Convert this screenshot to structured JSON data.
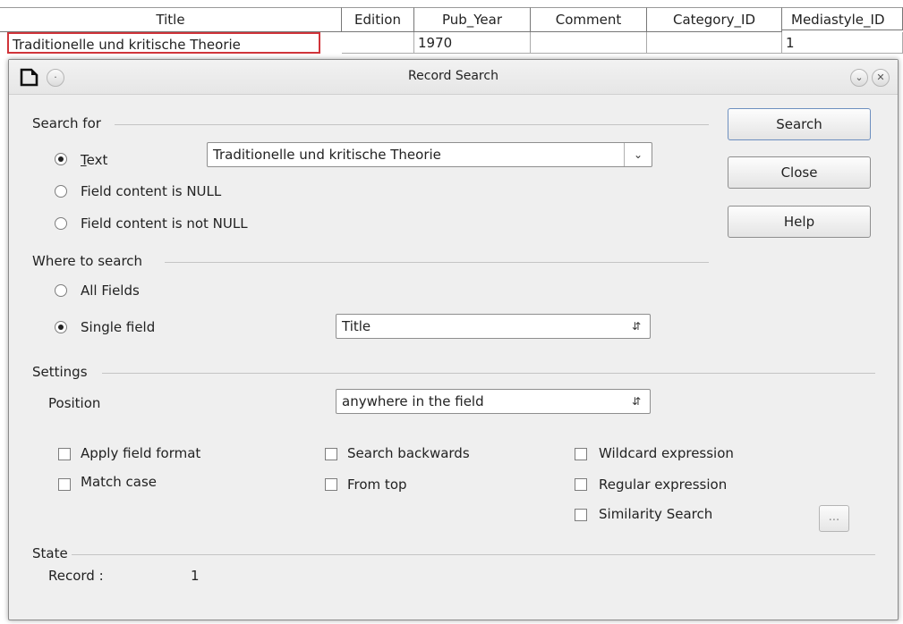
{
  "sheet": {
    "columns": [
      "Title",
      "Edition",
      "Pub_Year",
      "Comment",
      "Category_ID",
      "Mediastyle_ID"
    ],
    "row": [
      "Traditionelle und kritische Theorie",
      "",
      "1970",
      "",
      "",
      "1"
    ]
  },
  "dialog": {
    "title": "Record Search",
    "search_for": {
      "heading": "Search for",
      "text_option": "Text",
      "text_value": "Traditionelle und kritische Theorie",
      "null_option": "Field content is NULL",
      "not_null_option": "Field content is not NULL",
      "selected": "text"
    },
    "where": {
      "heading": "Where to search",
      "all_fields": "All Fields",
      "single_field": "Single field",
      "field_value": "Title",
      "selected": "single_field"
    },
    "settings": {
      "heading": "Settings",
      "position_label": "Position",
      "position_value": "anywhere in the field",
      "apply_field_format": "Apply field format",
      "match_case": "Match case",
      "search_backwards": "Search backwards",
      "from_top": "From top",
      "wildcard": "Wildcard expression",
      "regex": "Regular expression",
      "similarity": "Similarity Search",
      "similarity_btn": "..."
    },
    "state": {
      "heading": "State",
      "record_label": "Record :",
      "record_value": "1"
    },
    "buttons": {
      "search": "Search",
      "close": "Close",
      "help": "Help"
    }
  },
  "colors": {
    "selection_border": "#d0343a",
    "default_button_border": "#6d8fbf"
  }
}
